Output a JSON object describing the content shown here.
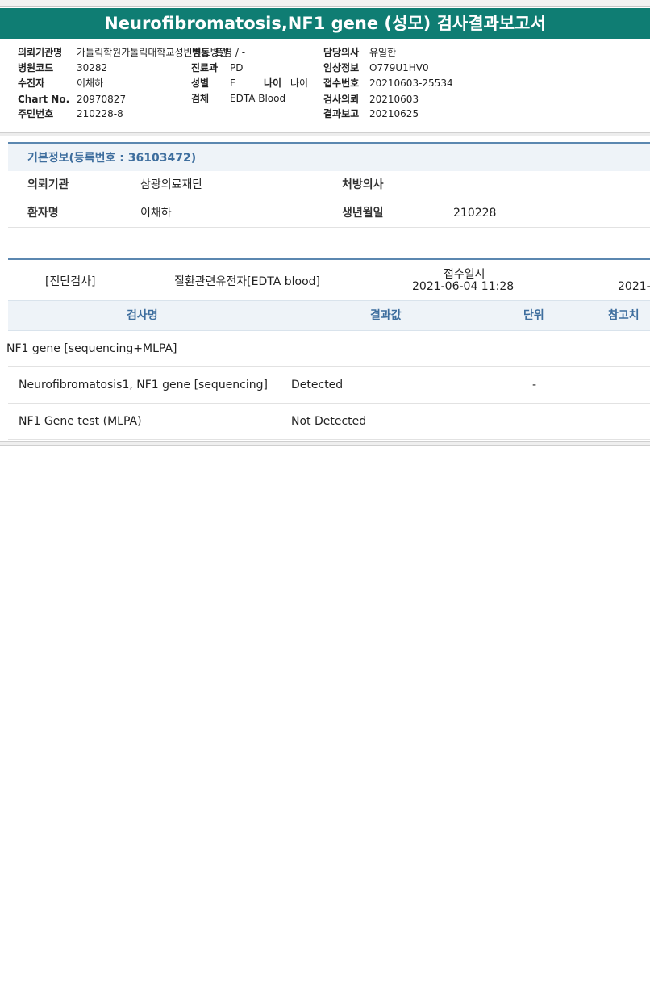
{
  "title": "Neurofibromatosis,NF1 gene (성모) 검사결과보고서",
  "header": {
    "col1": [
      {
        "label": "의뢰기관명",
        "value": "가톨릭학원가톨릭대학교성빈센트병원"
      },
      {
        "label": "병원코드",
        "value": "30282"
      },
      {
        "label": "수진자",
        "value": "이채하"
      },
      {
        "label": "Chart No.",
        "value": "20970827"
      },
      {
        "label": "주민번호",
        "value": "210228-8"
      }
    ],
    "ward_label": "병동",
    "ward_value": "트병 / -",
    "col2": [
      {
        "label": "진료과",
        "value": "PD"
      },
      {
        "label": "성별",
        "value": "F"
      },
      {
        "label": "검체",
        "value": "EDTA Blood"
      }
    ],
    "age_label": "나이",
    "age_value": "나이",
    "col3": [
      {
        "label": "담당의사",
        "value": "유일한"
      },
      {
        "label": "임상정보",
        "value": "O779U1HV0"
      },
      {
        "label": "접수번호",
        "value": "20210603-25534"
      },
      {
        "label": "검사의뢰",
        "value": "20210603"
      },
      {
        "label": "결과보고",
        "value": "20210625"
      }
    ]
  },
  "basic_info": {
    "heading": "기본정보(등록번호 : 36103472)",
    "institution_label": "의뢰기관",
    "institution_value": "삼광의료재단",
    "doctor_label": "처방의사",
    "doctor_value": "",
    "patient_label": "환자명",
    "patient_value": "이채하",
    "birth_label": "생년월일",
    "birth_value": "210228"
  },
  "test_meta": {
    "category": "[진단검사]",
    "test_name": "질환관련유전자[EDTA blood]",
    "received_label": "접수일시",
    "received_value": "2021-06-04  11:28",
    "report_value": "2021-"
  },
  "table": {
    "columns": [
      "검사명",
      "결과값",
      "단위",
      "참고치"
    ],
    "group": "NF1 gene [sequencing+MLPA]",
    "rows": [
      {
        "name": "Neurofibromatosis1, NF1 gene [sequencing]",
        "result": "Detected",
        "unit": "-",
        "ref": ""
      },
      {
        "name": "NF1 Gene test (MLPA)",
        "result": "Not Detected",
        "unit": "",
        "ref": ""
      }
    ]
  }
}
